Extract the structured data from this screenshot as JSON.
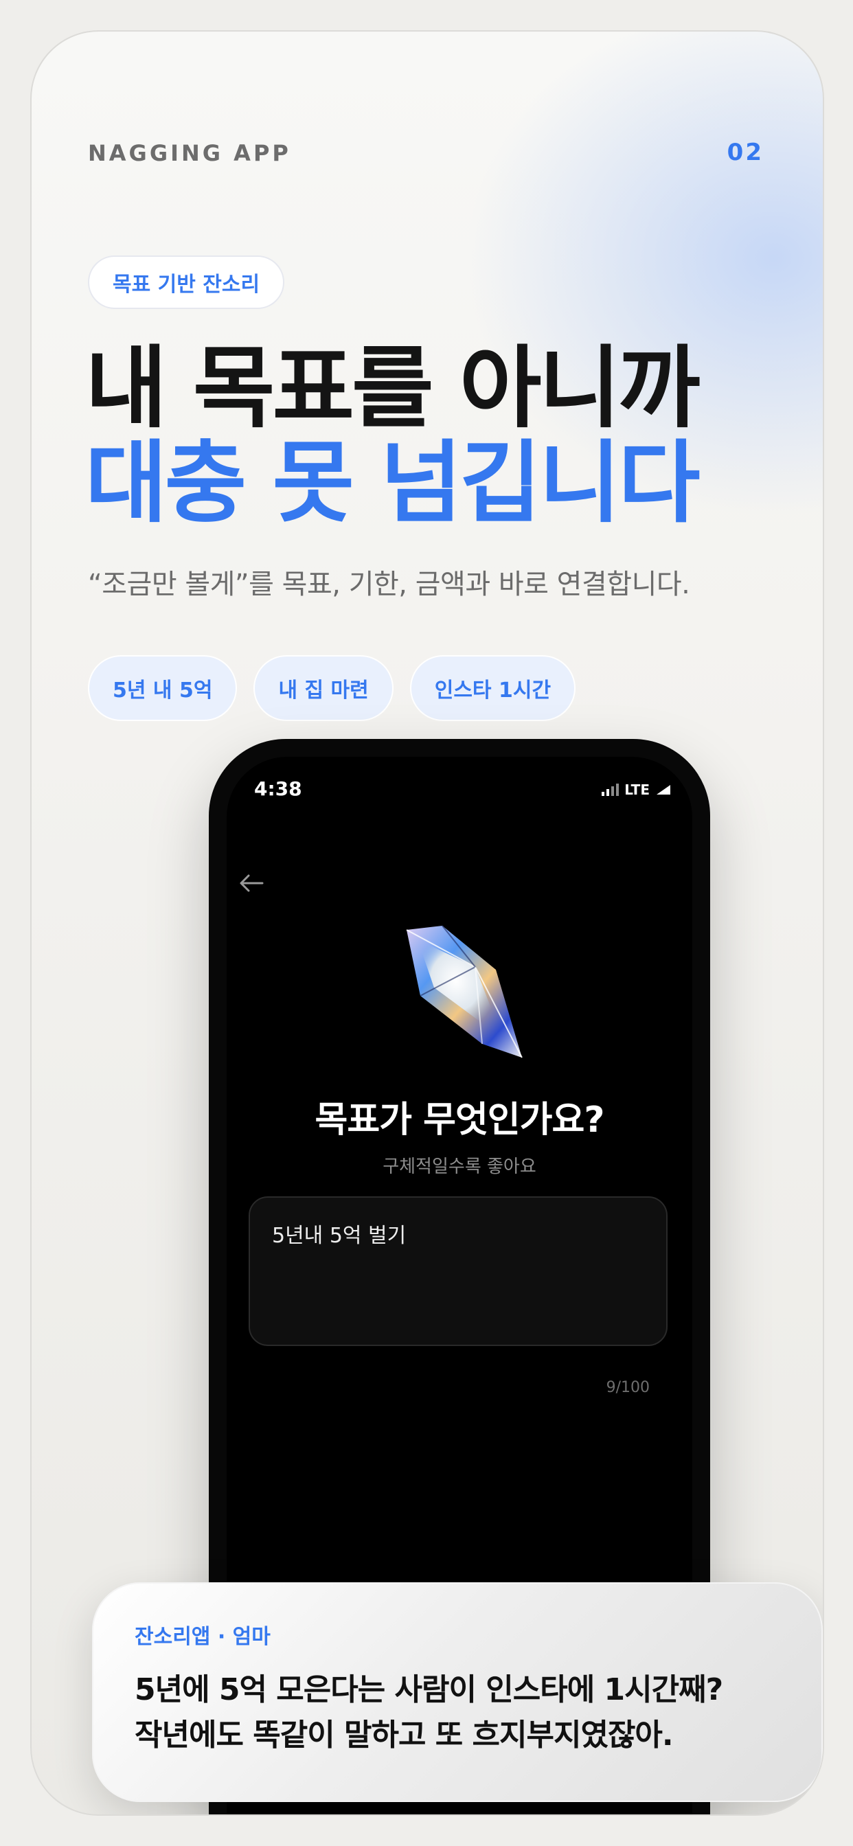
{
  "header": {
    "app_name": "NAGGING APP",
    "page_number": "02"
  },
  "badge": "목표 기반 잔소리",
  "headline": {
    "line1": "내 목표를 아니까",
    "line2": "대충 못 넘깁니다"
  },
  "subcopy": "“조금만 볼게”를 목표, 기한, 금액과 바로 연결합니다.",
  "chips": [
    "5년 내 5억",
    "내 집 마련",
    "인스타 1시간"
  ],
  "phone": {
    "status": {
      "time": "4:38",
      "network": "LTE"
    },
    "back_icon": "arrow-left-icon",
    "crystal_icon": "crystal-icon",
    "title": "목표가 무엇인가요?",
    "subtitle": "구체적일수록 좋아요",
    "goal_input": {
      "value": "5년내 5억 벌기"
    },
    "char_count": "9/100"
  },
  "quote": {
    "sender": "잔소리앱 · 엄마",
    "line1": "5년에 5억 모은다는 사람이 인스타에 1시간째?",
    "line2": "작년에도 똑같이 말하고 또 흐지부지였잖아."
  },
  "colors": {
    "accent": "#3578ef",
    "chip_bg": "#e9f0fd",
    "phone_bg": "#000000",
    "heading": "#141414"
  }
}
